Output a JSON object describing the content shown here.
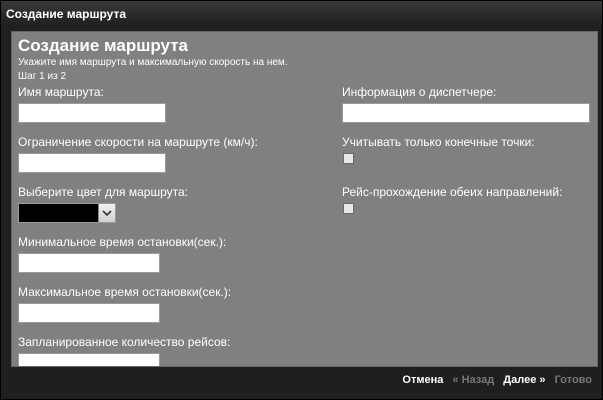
{
  "window": {
    "title": "Создание маршрута"
  },
  "form": {
    "heading": "Создание маршрута",
    "subtitle": "Укажите имя маршрута и максимальную скорость на нем.",
    "step": "Шаг 1 из 2",
    "fields": {
      "route_name": {
        "label": "Имя маршрута:",
        "value": ""
      },
      "speed_limit": {
        "label": "Ограничение скорости на маршруте (км/ч):",
        "value": ""
      },
      "route_color": {
        "label": "Выберите цвет для маршрута:",
        "value": "#000000"
      },
      "min_stop": {
        "label": "Минимальное время остановки(сек.):",
        "value": ""
      },
      "max_stop": {
        "label": "Максимальное время остановки(сек.):",
        "value": ""
      },
      "planned_trips": {
        "label": "Запланированное количество рейсов:",
        "value": ""
      },
      "dispatcher_info": {
        "label": "Информация о диспетчере:",
        "value": ""
      },
      "endpoints_only": {
        "label": "Учитывать только конечные точки:",
        "checked": false
      },
      "both_directions": {
        "label": "Рейс-прохождение обеих направлений:",
        "checked": false
      }
    }
  },
  "footer": {
    "cancel": "Отмена",
    "back": "« Назад",
    "next": "Далее »",
    "finish": "Готово"
  },
  "colors": {
    "panel": "#808080",
    "titlebar": "#1e1e1e",
    "text": "#ffffff",
    "disabled": "#777777"
  }
}
